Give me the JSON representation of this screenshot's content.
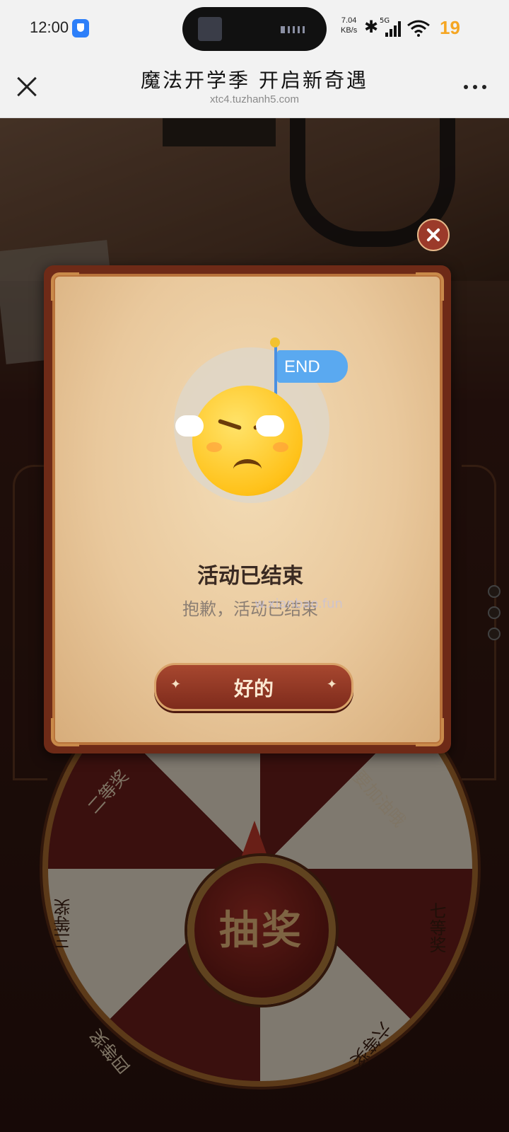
{
  "status_bar": {
    "time": "12:00",
    "net_speed": "7.04",
    "net_unit": "KB/s",
    "network": "5G",
    "battery": "19"
  },
  "nav": {
    "title": "魔法开学季 开启新奇遇",
    "url": "xtc4.tuzhanh5.com"
  },
  "wheel": {
    "prizes": [
      "二等奖",
      "三等奖",
      "要加油哦",
      "七等奖",
      "四等奖",
      "六等奖"
    ],
    "center_label": "抽奖"
  },
  "modal": {
    "flag_text": "END",
    "title": "活动已结束",
    "subtitle": "抱歉，活动已结束",
    "watermark": "w.xianbao.fun",
    "ok_label": "好的"
  }
}
